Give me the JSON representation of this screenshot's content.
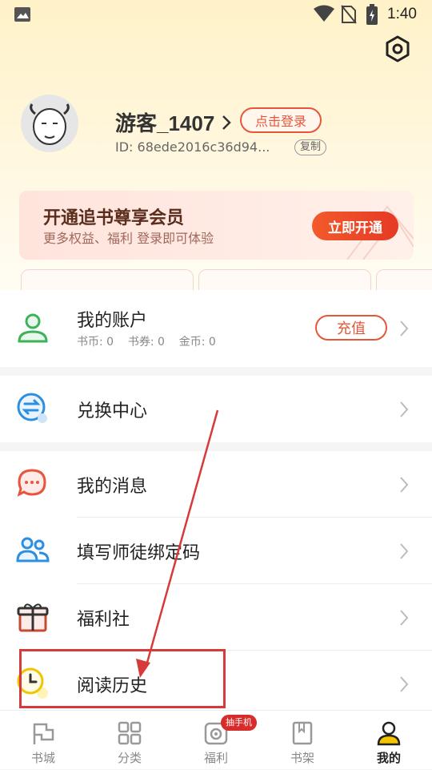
{
  "status_bar": {
    "time": "1:40"
  },
  "profile": {
    "username": "游客_1407",
    "login_label": "点击登录",
    "id_text": "ID: 68ede2016c36d94...",
    "copy_label": "复制"
  },
  "vip": {
    "title": "开通追书尊享会员",
    "subtitle": "更多权益、福利 登录即可体验",
    "button": "立即开通"
  },
  "account": {
    "label": "我的账户",
    "balance_text": "书币: 0    书券: 0    金币: 0",
    "recharge_label": "充值"
  },
  "menu": {
    "exchange": "兑换中心",
    "messages": "我的消息",
    "mentor_code": "填写师徒绑定码",
    "welfare_club": "福利社",
    "reading_history": "阅读历史"
  },
  "tabbar": {
    "items": [
      {
        "label": "书城",
        "icon": "flag-icon"
      },
      {
        "label": "分类",
        "icon": "grid-icon"
      },
      {
        "label": "福利",
        "icon": "gift-camera-icon"
      },
      {
        "label": "书架",
        "icon": "book-icon"
      },
      {
        "label": "我的",
        "icon": "person-icon"
      }
    ],
    "badge": "抽手机",
    "active": "我的"
  },
  "colors": {
    "accent": "#e6563a",
    "highlight": "#d63a3a",
    "header_bg": "#fff2c8"
  }
}
